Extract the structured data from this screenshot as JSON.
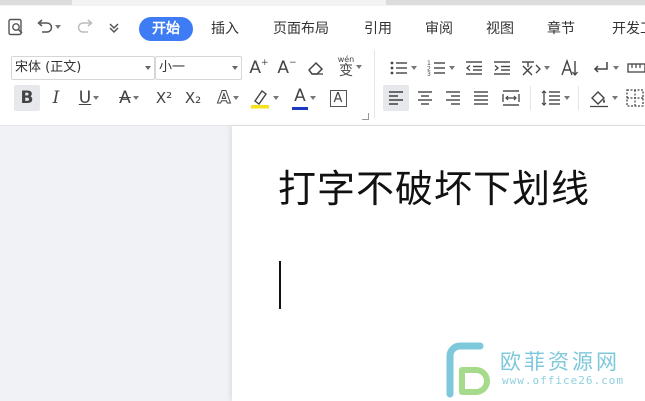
{
  "quick_access": {
    "icons": [
      "print-preview-icon",
      "undo-icon",
      "redo-icon",
      "customize-icon"
    ]
  },
  "tabs": [
    {
      "label": "开始",
      "active": true
    },
    {
      "label": "插入"
    },
    {
      "label": "页面布局"
    },
    {
      "label": "引用"
    },
    {
      "label": "审阅"
    },
    {
      "label": "视图"
    },
    {
      "label": "章节"
    },
    {
      "label": "开发工"
    }
  ],
  "font": {
    "family_value": "宋体 (正文)",
    "size_value": "小一"
  },
  "format_buttons": {
    "bold": "B",
    "italic": "I",
    "underline": "U",
    "strikethrough": "A",
    "superscript": "X²",
    "subscript": "X₂",
    "text_effect": "A",
    "font_color": "A",
    "char_border": "A",
    "increase_font": "A",
    "decrease_font": "A",
    "phonetic": "wén",
    "phonetic_char": "变"
  },
  "document": {
    "title": "打字不破坏下划线"
  },
  "watermark": {
    "name": "欧菲资源网",
    "url": "www.office26.com"
  },
  "colors": {
    "accent": "#3d7cf4",
    "highlight": "#f5e11c",
    "font_color_bar": "#1d39c4",
    "watermark": "#7ec8dc"
  }
}
